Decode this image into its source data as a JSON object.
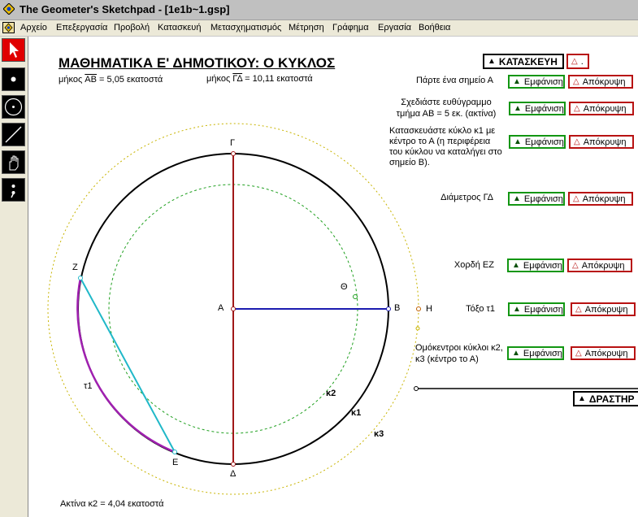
{
  "window": {
    "title": "The Geometer's Sketchpad - [1e1b~1.gsp]"
  },
  "menu": [
    "Αρχείο",
    "Επεξεργασία",
    "Προβολή",
    "Κατασκευή",
    "Μετασχηματισμός",
    "Μέτρηση",
    "Γράφημα",
    "Εργασία",
    "Βοήθεια"
  ],
  "tools": [
    "selection-arrow",
    "point",
    "compass",
    "straightedge",
    "text-hand",
    "script"
  ],
  "sketch": {
    "heading": "ΜΑΘΗΜΑΤΙΚΑ Ε' ΔΗΜΟΤΙΚΟΥ: Ο ΚΥΚΛΟΣ",
    "measure_ab": {
      "prefix": "μήκος ",
      "seg": "AB",
      "suffix": " = 5,05 εκατοστά"
    },
    "measure_gd": {
      "prefix": "μήκος ",
      "seg": "ΓΔ",
      "suffix": " = 10,11 εκατοστά"
    },
    "radius_k2": "Ακτίνα κ2 = 4,04 εκατοστά",
    "construct_button": "ΚΑΤΑΣΚΕΥΗ",
    "activity_button": "ΔΡΑΣΤΗΡ",
    "steps": [
      {
        "text": "Πάρτε ένα σημείο Α",
        "show": "Εμφάνιση",
        "hide": "Απόκρυψη"
      },
      {
        "text": "Σχεδιάστε ευθύγραμμο τμήμα ΑΒ = 5 εκ. (ακτίνα)",
        "show": "Εμφάνιση",
        "hide": "Απόκρυψη"
      },
      {
        "text": "Κατασκευάστε κύκλο κ1 με κέντρο το Α (η περιφέρεια του κύκλου να καταλήγει στο σημείο Β).",
        "show": "Εμφάνιση",
        "hide": "Απόκρυψη"
      },
      {
        "text": "Διάμετρος ΓΔ",
        "show": "Εμφάνιση",
        "hide": "Απόκρυψη"
      },
      {
        "text": "Χορδή ΕΖ",
        "show": "Εμφάνιση",
        "hide": "Απόκρυψη"
      },
      {
        "text": "Τόξο τ1",
        "show": "Εμφάνιση",
        "hide": "Απόκρυψη"
      },
      {
        "text": "Ομόκεντροι κύκλοι κ2, κ3 (κέντρο το Α)",
        "show": "Εμφάνιση",
        "hide": "Απόκρυψη"
      }
    ],
    "labels": {
      "A": "Α",
      "B": "Β",
      "G": "Γ",
      "D": "Δ",
      "E": "Ε",
      "Z": "Ζ",
      "H": "Η",
      "TH": "Θ",
      "k1": "κ1",
      "k2": "κ2",
      "k3": "κ3",
      "t1": "τ1"
    },
    "colors": {
      "circle_k1": "#000000",
      "circle_k2": "#20a020",
      "circle_k3": "#c8b400",
      "diameter": "#a01818",
      "radius": "#1c1cb0",
      "chord": "#20b8c8",
      "arc": "#a020b0"
    }
  }
}
